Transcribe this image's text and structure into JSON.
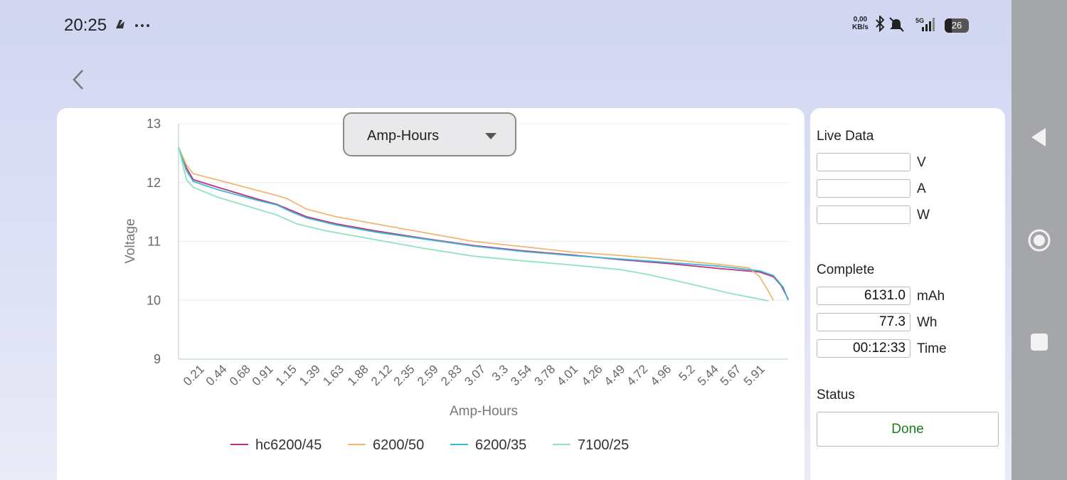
{
  "status_bar": {
    "time": "20:25",
    "net_speed_value": "0,00",
    "net_speed_unit": "KB/s",
    "network": "5G",
    "battery": "26"
  },
  "dropdown": {
    "selected": "Amp-Hours"
  },
  "chart_data": {
    "type": "line",
    "xlabel": "Amp-Hours",
    "ylabel": "Voltage",
    "ylim": [
      9,
      13
    ],
    "xlim": [
      0,
      6.2
    ],
    "yticks": [
      9,
      10,
      11,
      12,
      13
    ],
    "xtick_labels": [
      "0.21",
      "0.44",
      "0.68",
      "0.91",
      "1.15",
      "1.39",
      "1.63",
      "1.88",
      "2.12",
      "2.35",
      "2.59",
      "2.83",
      "3.07",
      "3.3",
      "3.54",
      "3.78",
      "4.01",
      "4.26",
      "4.49",
      "4.72",
      "4.96",
      "5.2",
      "5.44",
      "5.67",
      "5.91"
    ],
    "grid": true,
    "legend": "bottom",
    "series": [
      {
        "name": "hc6200/45",
        "color": "#c2307a",
        "points": [
          [
            0,
            12.6
          ],
          [
            0.08,
            12.25
          ],
          [
            0.15,
            12.05
          ],
          [
            0.4,
            11.92
          ],
          [
            0.8,
            11.72
          ],
          [
            1.0,
            11.63
          ],
          [
            1.1,
            11.56
          ],
          [
            1.3,
            11.42
          ],
          [
            1.6,
            11.3
          ],
          [
            2.0,
            11.18
          ],
          [
            2.5,
            11.05
          ],
          [
            3.0,
            10.93
          ],
          [
            3.5,
            10.84
          ],
          [
            4.0,
            10.77
          ],
          [
            4.5,
            10.69
          ],
          [
            5.0,
            10.62
          ],
          [
            5.5,
            10.54
          ],
          [
            5.91,
            10.48
          ],
          [
            6.05,
            10.4
          ],
          [
            6.13,
            10.25
          ],
          [
            6.2,
            10.02
          ]
        ]
      },
      {
        "name": "6200/50",
        "color": "#f0b774",
        "points": [
          [
            0,
            12.6
          ],
          [
            0.08,
            12.3
          ],
          [
            0.15,
            12.15
          ],
          [
            0.5,
            12.0
          ],
          [
            1.0,
            11.78
          ],
          [
            1.1,
            11.73
          ],
          [
            1.3,
            11.55
          ],
          [
            1.6,
            11.42
          ],
          [
            2.0,
            11.3
          ],
          [
            2.5,
            11.15
          ],
          [
            3.0,
            11.0
          ],
          [
            3.5,
            10.91
          ],
          [
            4.0,
            10.82
          ],
          [
            4.5,
            10.76
          ],
          [
            5.0,
            10.69
          ],
          [
            5.5,
            10.61
          ],
          [
            5.8,
            10.55
          ],
          [
            5.91,
            10.4
          ],
          [
            6.0,
            10.15
          ],
          [
            6.05,
            10.0
          ]
        ]
      },
      {
        "name": "6200/35",
        "color": "#3ab8da",
        "points": [
          [
            0,
            12.6
          ],
          [
            0.08,
            12.2
          ],
          [
            0.15,
            12.02
          ],
          [
            0.4,
            11.88
          ],
          [
            0.8,
            11.7
          ],
          [
            1.0,
            11.62
          ],
          [
            1.15,
            11.5
          ],
          [
            1.3,
            11.4
          ],
          [
            1.6,
            11.28
          ],
          [
            2.0,
            11.16
          ],
          [
            2.5,
            11.04
          ],
          [
            3.0,
            10.92
          ],
          [
            3.5,
            10.83
          ],
          [
            4.0,
            10.76
          ],
          [
            4.5,
            10.7
          ],
          [
            5.0,
            10.64
          ],
          [
            5.5,
            10.58
          ],
          [
            5.91,
            10.5
          ],
          [
            6.05,
            10.42
          ],
          [
            6.15,
            10.22
          ],
          [
            6.2,
            10.0
          ]
        ]
      },
      {
        "name": "7100/25",
        "color": "#8fe3bd",
        "points": [
          [
            0,
            12.6
          ],
          [
            0.08,
            12.05
          ],
          [
            0.15,
            11.92
          ],
          [
            0.4,
            11.75
          ],
          [
            0.8,
            11.55
          ],
          [
            1.0,
            11.45
          ],
          [
            1.2,
            11.3
          ],
          [
            1.5,
            11.18
          ],
          [
            2.0,
            11.03
          ],
          [
            2.5,
            10.88
          ],
          [
            3.0,
            10.75
          ],
          [
            3.5,
            10.67
          ],
          [
            4.0,
            10.6
          ],
          [
            4.5,
            10.52
          ],
          [
            4.8,
            10.43
          ],
          [
            5.2,
            10.28
          ],
          [
            5.6,
            10.12
          ],
          [
            5.91,
            10.02
          ],
          [
            6.0,
            9.99
          ]
        ]
      }
    ]
  },
  "side_panel": {
    "live_data_title": "Live Data",
    "live_fields": [
      {
        "value": "",
        "unit": "V"
      },
      {
        "value": "",
        "unit": "A"
      },
      {
        "value": "",
        "unit": "W"
      }
    ],
    "complete_title": "Complete",
    "complete_fields": [
      {
        "value": "6131.0",
        "unit": "mAh"
      },
      {
        "value": "77.3",
        "unit": "Wh"
      },
      {
        "value": "00:12:33",
        "unit": "Time"
      }
    ],
    "status_title": "Status",
    "status_value": "Done"
  }
}
